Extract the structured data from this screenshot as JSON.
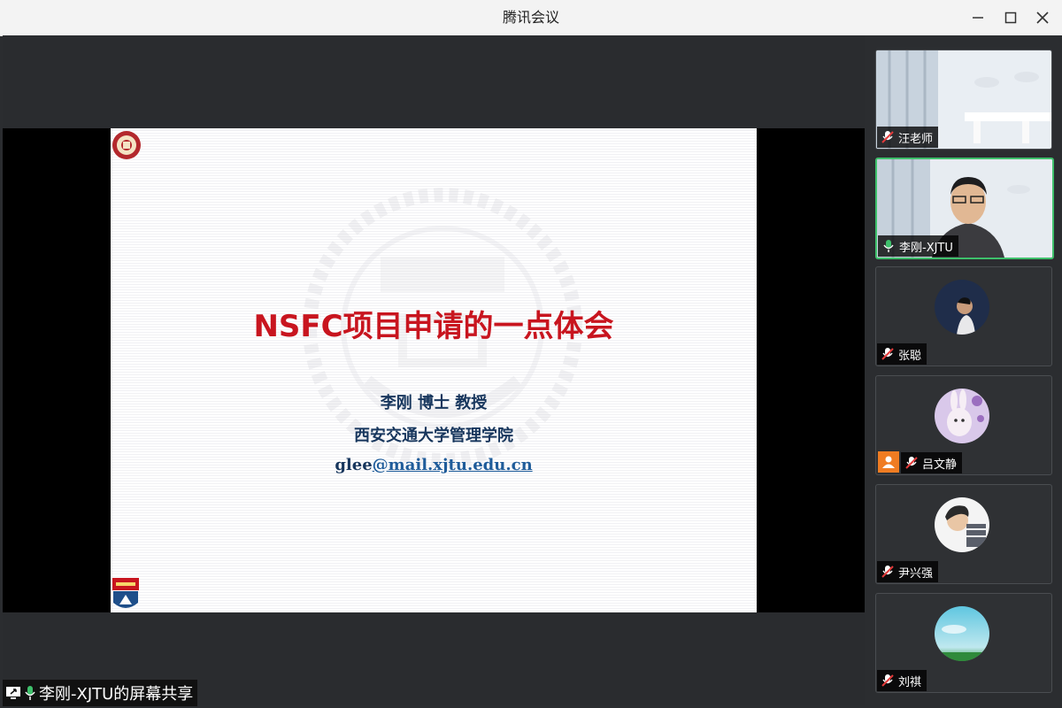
{
  "window": {
    "title": "腾讯会议",
    "controls": [
      "minimize-icon",
      "maximize-icon",
      "close-icon"
    ]
  },
  "slide": {
    "title": "NSFC项目申请的一点体会",
    "presenter": "李刚 博士 教授",
    "affiliation": "西安交通大学管理学院",
    "email_user": "glee",
    "email_domain": "@mail.xjtu.edu.cn"
  },
  "share_label": {
    "text": "李刚-XJTU的屏幕共享"
  },
  "participants": [
    {
      "name": "汪老师",
      "mic": "muted"
    },
    {
      "name": "李刚-XJTU",
      "mic": "active",
      "speaking": true
    },
    {
      "name": "张聪",
      "mic": "muted"
    },
    {
      "name": "吕文静",
      "mic": "muted",
      "host": true
    },
    {
      "name": "尹兴强",
      "mic": "muted"
    },
    {
      "name": "刘祺",
      "mic": "muted"
    }
  ],
  "colors": {
    "accent_green": "#3ec06b",
    "slide_title_red": "#c8151f",
    "slide_text_navy": "#17365d",
    "host_orange": "#f07c22"
  }
}
